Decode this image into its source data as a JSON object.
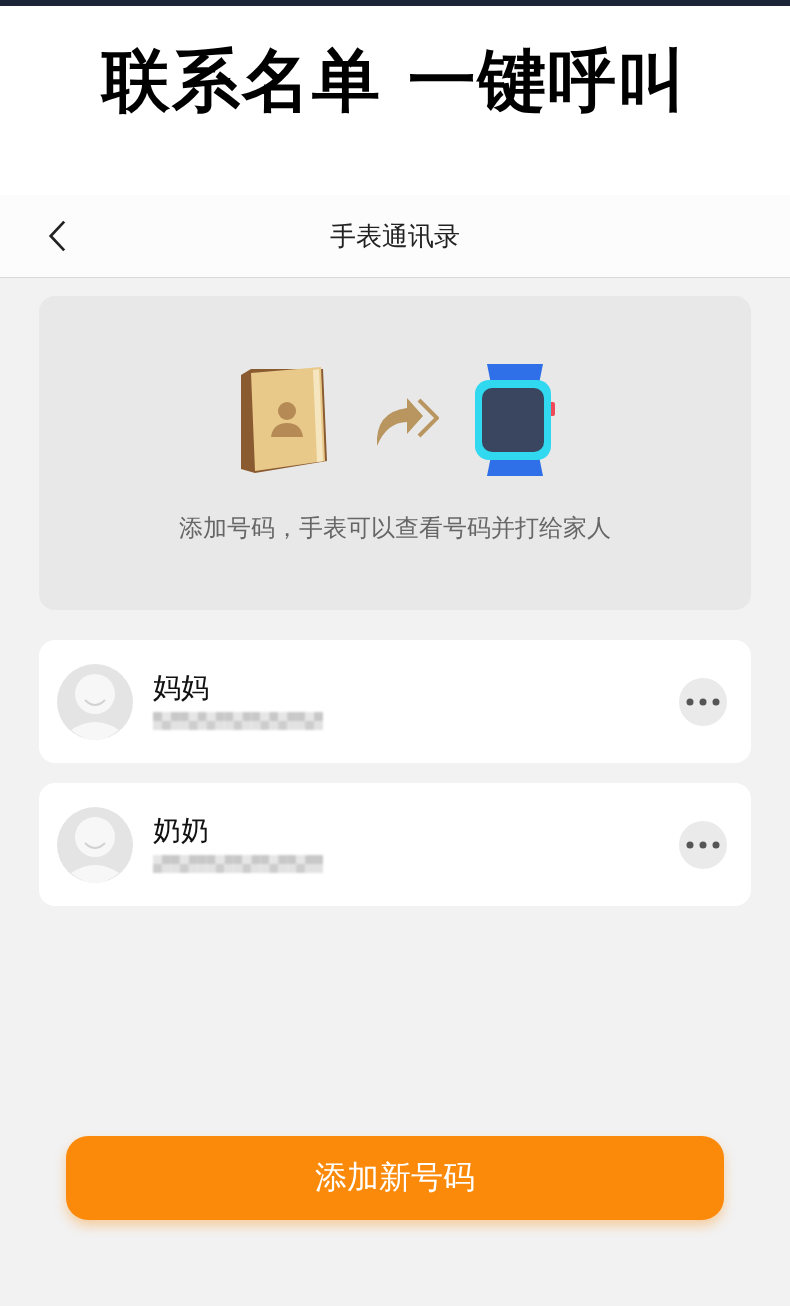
{
  "headline": "联系名单 一键呼叫",
  "nav": {
    "title": "手表通讯录"
  },
  "banner": {
    "caption": "添加号码，手表可以查看号码并打给家人"
  },
  "contacts": [
    {
      "name": "妈妈"
    },
    {
      "name": "奶奶"
    }
  ],
  "add_button": {
    "label": "添加新号码"
  }
}
